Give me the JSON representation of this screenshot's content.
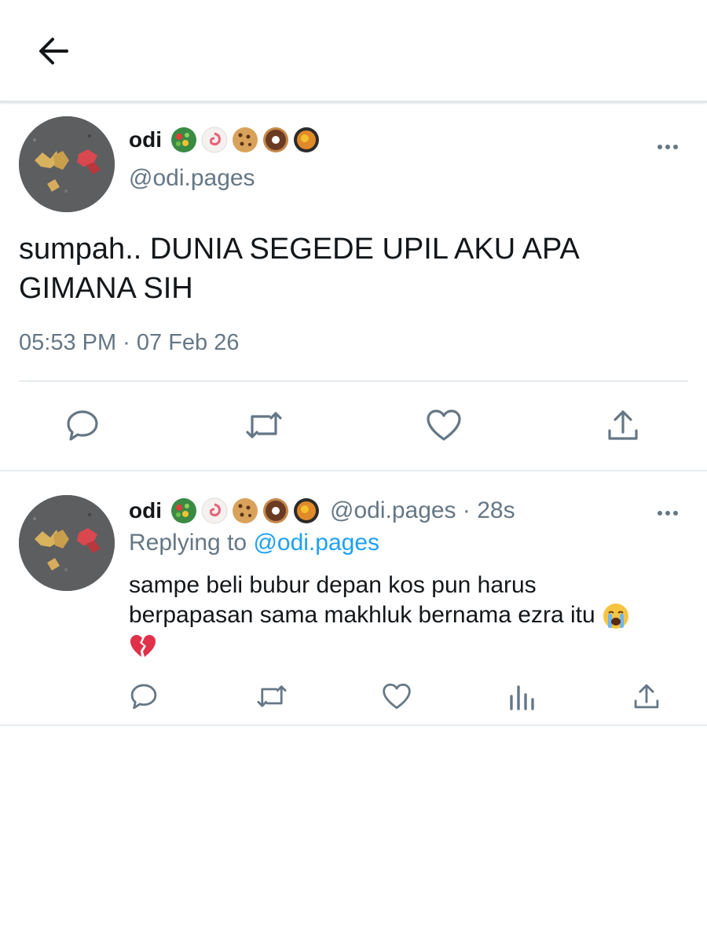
{
  "header": {
    "back_icon": "arrow-left-icon"
  },
  "tweet": {
    "display_name": "odi",
    "badge_icons": [
      "salad-bowl-icon",
      "fish-cake-icon",
      "cookie-icon",
      "doughnut-icon",
      "pan-food-icon"
    ],
    "handle": "@odi.pages",
    "text": "sumpah.. DUNIA SEGEDE UPIL AKU APA GIMANA SIH",
    "timestamp": "05:53 PM · 07 Feb 26",
    "actions": [
      "reply-icon",
      "retweet-icon",
      "like-icon",
      "share-icon"
    ]
  },
  "reply": {
    "display_name": "odi",
    "meta": "@odi.pages · 28s",
    "replying_prefix": "Replying to ",
    "replying_handle": "@odi.pages",
    "text_line1": "sampe beli bubur depan kos pun harus",
    "text_line2": "berpapasan sama makhluk bernama ezra itu",
    "text_emojis": [
      "loudly-crying-face-icon",
      "broken-heart-icon"
    ],
    "actions": [
      "reply-icon",
      "retweet-icon",
      "like-icon",
      "analytics-icon",
      "share-icon"
    ]
  },
  "colors": {
    "text": "#14171a",
    "secondary": "#657786",
    "accent": "#1da1f2",
    "divider": "#e6ecf0"
  }
}
